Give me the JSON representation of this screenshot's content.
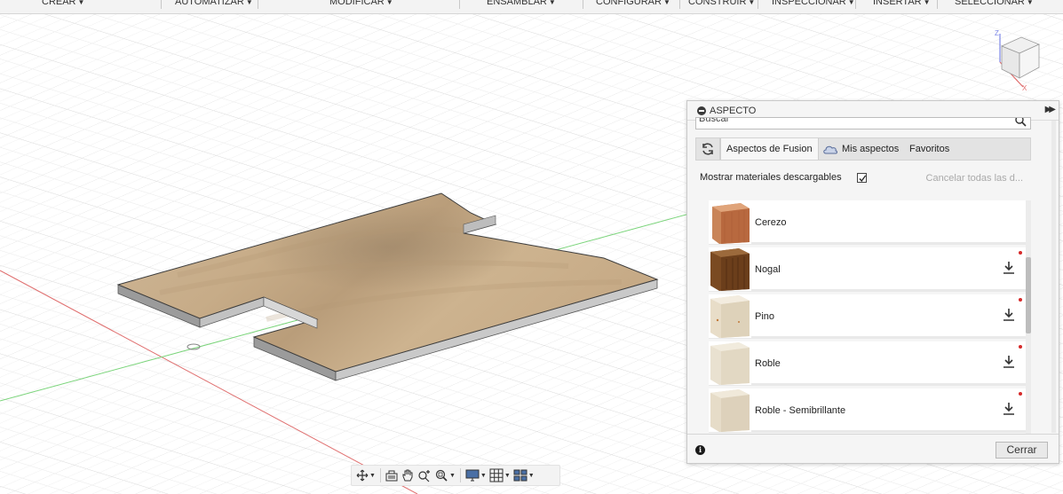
{
  "toolbar": {
    "items": [
      {
        "label": "CREAR"
      },
      {
        "label": "AUTOMATIZAR"
      },
      {
        "label": "MODIFICAR"
      },
      {
        "label": "ENSAMBLAR"
      },
      {
        "label": "CONFIGURAR"
      },
      {
        "label": "CONSTRUIR"
      },
      {
        "label": "INSPECCIONAR"
      },
      {
        "label": "INSERTAR"
      },
      {
        "label": "SELECCIONAR"
      }
    ]
  },
  "viewcube": {
    "axis_z": "Z",
    "axis_x": "X"
  },
  "panel": {
    "title": "ASPECTO",
    "search_placeholder": "Buscar",
    "tabs": [
      {
        "label": "Aspectos de Fusion",
        "active": true
      },
      {
        "label": "Mis aspectos",
        "active": false
      },
      {
        "label": "Favoritos",
        "active": false
      }
    ],
    "show_downloadable_label": "Mostrar materiales descargables",
    "show_downloadable_checked": true,
    "cancel_all_label": "Cancelar todas las d...",
    "materials": [
      {
        "name": "Cerezo",
        "downloadable": false,
        "icon": "cherry-wood"
      },
      {
        "name": "Nogal",
        "downloadable": true,
        "icon": "walnut-wood"
      },
      {
        "name": "Pino",
        "downloadable": true,
        "icon": "pine-wood"
      },
      {
        "name": "Roble",
        "downloadable": true,
        "icon": "oak-wood"
      },
      {
        "name": "Roble - Semibrillante",
        "downloadable": true,
        "icon": "oak-semigloss-wood"
      }
    ],
    "close_label": "Cerrar"
  },
  "colors": {
    "x_axis": "#e05a5a",
    "y_axis": "#5ec85e",
    "wood_top": "#c9ae8a",
    "wood_side": "#a7a7a7",
    "notification_dot": "#d62a2a"
  }
}
